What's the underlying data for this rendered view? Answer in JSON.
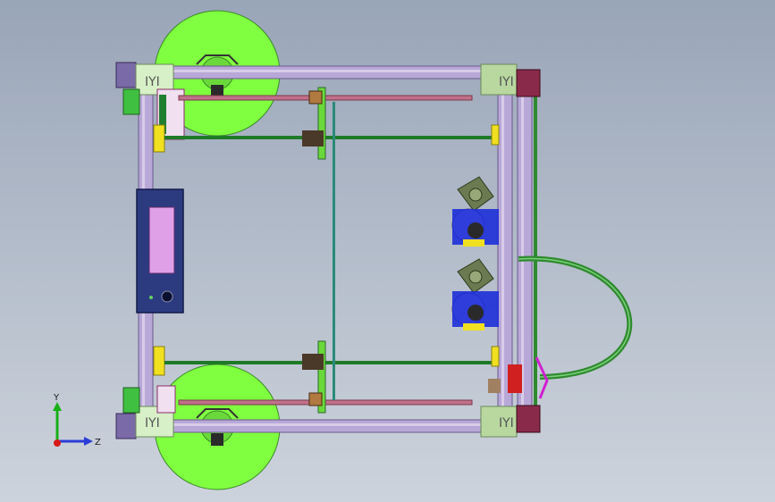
{
  "viewport": {
    "background_top": "#99a5b8",
    "background_bottom": "#cdd3dc"
  },
  "triad": {
    "y_label": "Y",
    "z_label": "Z",
    "y_color": "#18b018",
    "z_color": "#2a3cd8",
    "x_color": "#d81818"
  },
  "colors": {
    "frame_rail": "#b8a8d8",
    "spool": "#80ff40",
    "corner_bracket": "#b8d8a0",
    "motor": "#6b7a50",
    "extruder_gear": "#1d2fd8",
    "filament_tube": "#2f8a2f",
    "lcd_panel": "#2c3b80",
    "lcd_screen": "#e0a0e8",
    "endstop": "#f0e020",
    "bearing": "#4a3828",
    "gantry_rod": "#1f7a28",
    "pink_rod": "#c0708a"
  },
  "icons": {
    "bracket_mark": "IYI"
  }
}
